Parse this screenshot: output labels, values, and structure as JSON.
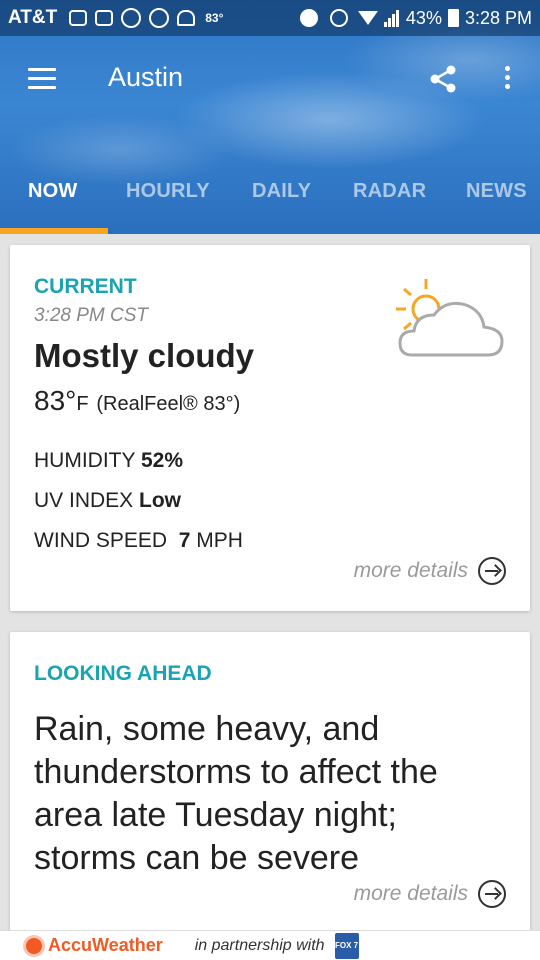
{
  "status_bar": {
    "carrier": "AT&T",
    "temperature": "83°",
    "battery": "43%",
    "time": "3:28 PM"
  },
  "toolbar": {
    "title": "Austin",
    "menu_icon": "hamburger-menu-icon",
    "share_icon": "share-icon",
    "more_icon": "more-vertical-icon"
  },
  "tabs": [
    {
      "label": "NOW",
      "active": true
    },
    {
      "label": "HOURLY",
      "active": false
    },
    {
      "label": "DAILY",
      "active": false
    },
    {
      "label": "RADAR",
      "active": false
    },
    {
      "label": "NEWS",
      "active": false
    }
  ],
  "current": {
    "section_label": "CURRENT",
    "time": "3:28 PM CST",
    "condition": "Mostly cloudy",
    "temperature": "83°",
    "unit": "F",
    "realfeel": "(RealFeel® 83°)",
    "icon": "partly-cloudy-icon",
    "humidity_label": "HUMIDITY",
    "humidity_value": "52%",
    "uv_label": "UV INDEX",
    "uv_value": "Low",
    "wind_label": "WIND SPEED",
    "wind_value": "7",
    "wind_unit": "MPH",
    "more_details": "more details"
  },
  "looking_ahead": {
    "section_label": "LOOKING AHEAD",
    "text": "Rain, some heavy, and thunderstorms to affect the area late Tuesday night; storms can be severe",
    "more_details": "more details"
  },
  "footer": {
    "brand": "AccuWeather",
    "partnership_text": "in partnership with",
    "partner_logo": "FOX 7"
  },
  "colors": {
    "accent_teal": "#1aa4b3",
    "tab_indicator": "#f6a623",
    "brand_orange": "#f15a22",
    "header_blue": "#3b86d3"
  }
}
